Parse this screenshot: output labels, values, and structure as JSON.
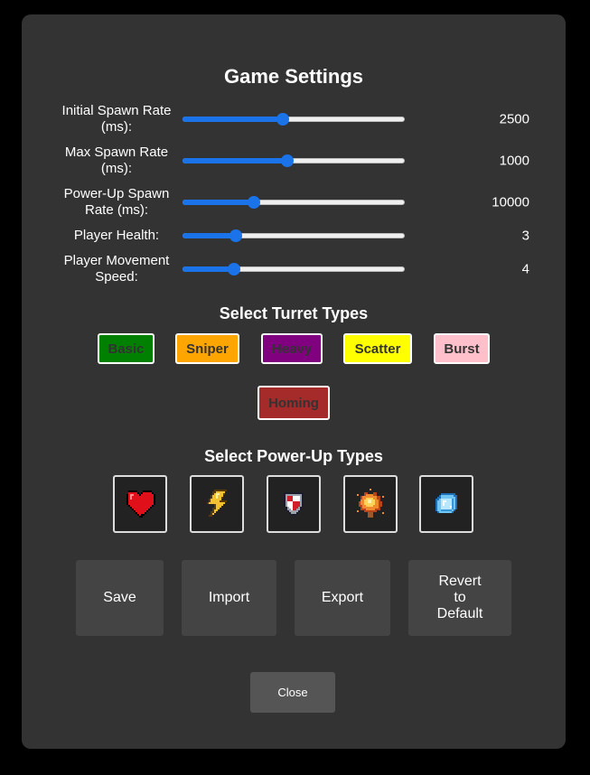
{
  "title": "Game Settings",
  "sliders": [
    {
      "label": "Initial Spawn Rate (ms):",
      "value": "2500",
      "fraction": 0.45
    },
    {
      "label": "Max Spawn Rate (ms):",
      "value": "1000",
      "fraction": 0.47
    },
    {
      "label": "Power-Up Spawn Rate (ms):",
      "value": "10000",
      "fraction": 0.32
    },
    {
      "label": "Player Health:",
      "value": "3",
      "fraction": 0.24
    },
    {
      "label": "Player Movement Speed:",
      "value": "4",
      "fraction": 0.23
    }
  ],
  "turret_section": {
    "title": "Select Turret Types",
    "buttons": [
      {
        "label": "Basic",
        "color": "#008000"
      },
      {
        "label": "Sniper",
        "color": "#FFA500"
      },
      {
        "label": "Heavy",
        "color": "#800080"
      },
      {
        "label": "Scatter",
        "color": "#FFFF00"
      },
      {
        "label": "Burst",
        "color": "#FFC0CB"
      },
      {
        "label": "Homing",
        "color": "#A52A2A"
      }
    ]
  },
  "powerup_section": {
    "title": "Select Power-Up Types",
    "items": [
      {
        "icon": "heart-icon"
      },
      {
        "icon": "lightning-icon"
      },
      {
        "icon": "shield-icon"
      },
      {
        "icon": "explosion-icon"
      },
      {
        "icon": "ice-cube-icon"
      }
    ]
  },
  "actions": {
    "save": "Save",
    "import": "Import",
    "export": "Export",
    "revert": "Revert to Default"
  },
  "close": "Close",
  "colors": {
    "accent": "#1a73e8",
    "panel": "#333333",
    "button": "#444444"
  }
}
